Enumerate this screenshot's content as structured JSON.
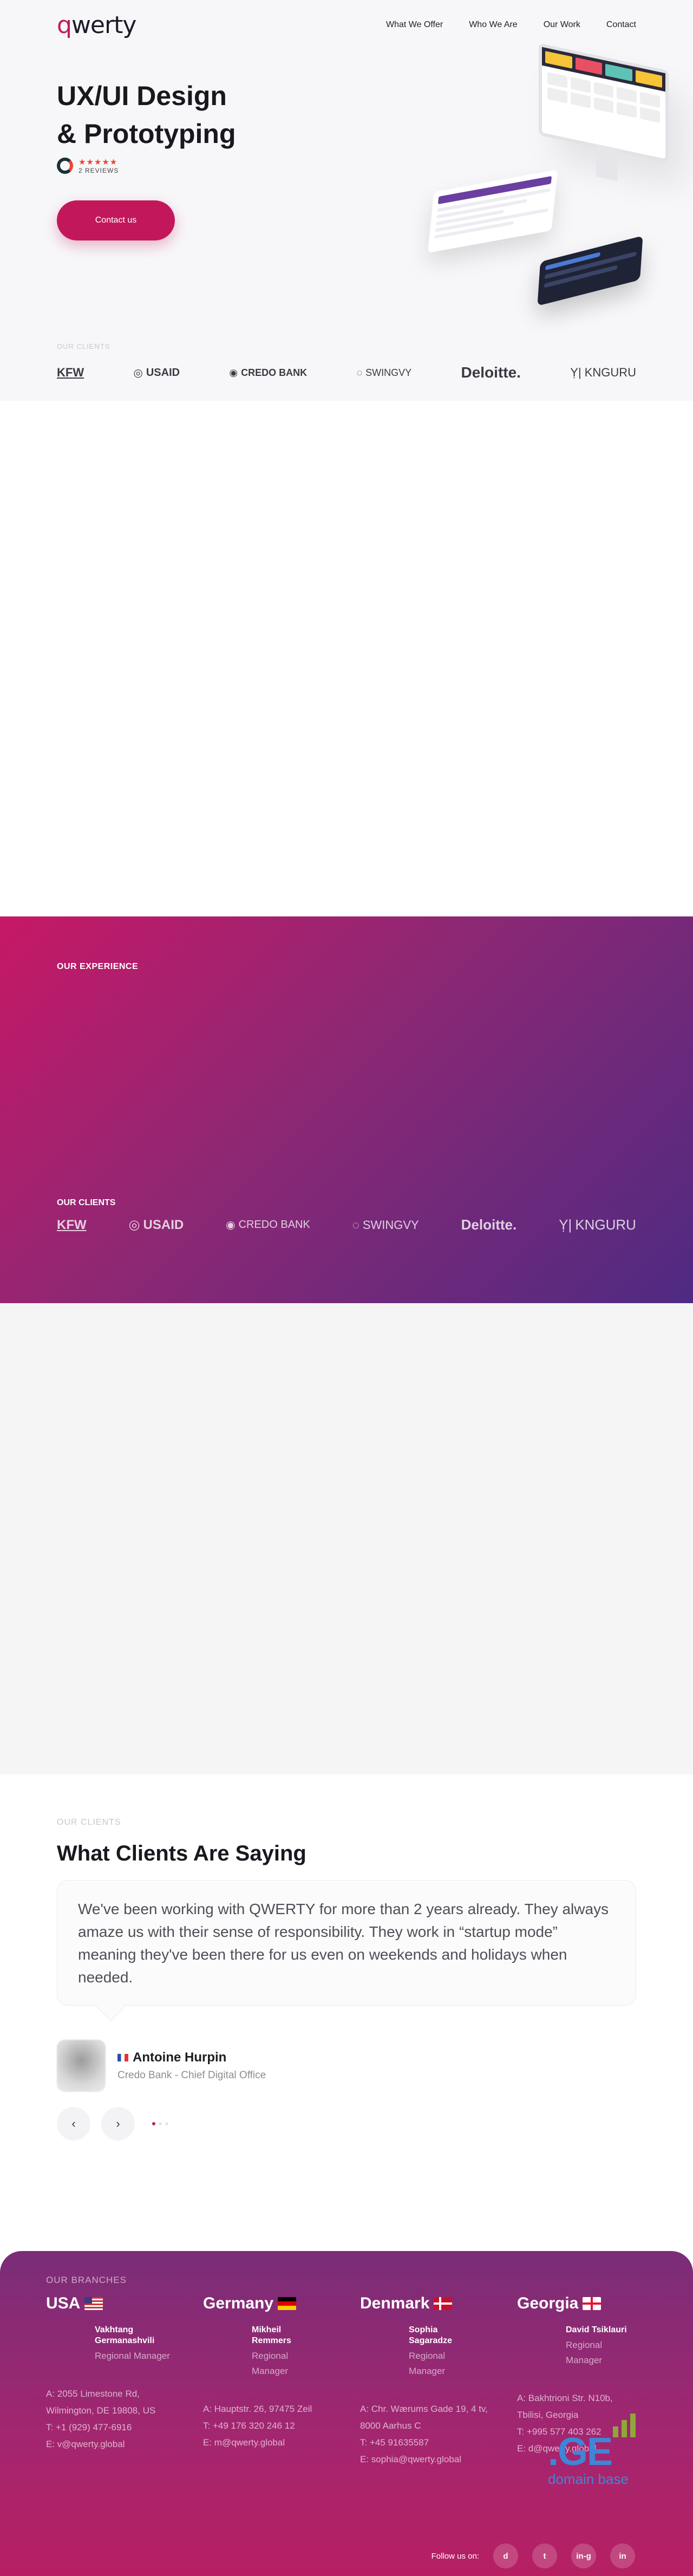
{
  "brand": {
    "logo_prefix": "q",
    "logo_rest": "werty"
  },
  "nav": {
    "items": [
      "What We Offer",
      "Who We Are",
      "Our Work",
      "Contact"
    ]
  },
  "hero": {
    "title_line1": "UX/UI Design",
    "title_line2": "& Prototyping",
    "stars": "★★★★★",
    "reviews": "2 REVIEWS",
    "cta": "Contact us"
  },
  "clients": {
    "label": "OUR CLIENTS",
    "logos": [
      "KFW",
      "USAID",
      "CREDO BANK",
      "SWINGVY",
      "Deloitte.",
      "KNGURU"
    ]
  },
  "experience": {
    "label": "OUR EXPERIENCE",
    "clients_label": "OUR CLIENTS",
    "logos": [
      "KFW",
      "USAID",
      "CREDO BANK",
      "SWINGVY",
      "Deloitte.",
      "KNGURU"
    ]
  },
  "testimonials": {
    "label": "OUR CLIENTS",
    "title": "What Clients Are Saying",
    "quote": "We've been working with QWERTY for more than 2 years already. They always amaze us with their sense of responsibility. They work in “startup mode” meaning they've been there for us even on weekends and holidays when needed.",
    "author_name": "Antoine Hurpin",
    "author_role": "Credo Bank - Chief Digital Office",
    "prev": "‹",
    "next": "›"
  },
  "footer": {
    "branches_label": "OUR BRANCHES",
    "branches": [
      {
        "country": "USA",
        "manager": "Vakhtang Germanashvili",
        "role": "Regional Manager",
        "address": "A:   2055 Limestone Rd, Wilmington, DE 19808, US",
        "phone": "T: +1 (929) 477-6916",
        "email": "E: v@qwerty.global"
      },
      {
        "country": "Germany",
        "manager": "Mikheil Remmers",
        "role": "Regional Manager",
        "address": "A:  Hauptstr. 26, 97475 Zeil",
        "phone": "T: +49 176 320 246 12",
        "email": "E: m@qwerty.global"
      },
      {
        "country": "Denmark",
        "manager": "Sophia Sagaradze",
        "role": "Regional Manager",
        "address": "A:  Chr. Wærums Gade 19, 4 tv, 8000 Aarhus C",
        "phone": "T: +45 91635587",
        "email": "E: sophia@qwerty.global"
      },
      {
        "country": "Georgia",
        "manager": "David Tsiklauri",
        "role": "Regional Manager",
        "address": "A:  Bakhtrioni Str. N10b, Tbilisi, Georgia",
        "phone": "T: +995 577 403 262",
        "email": "E: d@qwerty.global"
      }
    ],
    "follow": "Follow us on:",
    "social": [
      "d",
      "t",
      "in-g",
      "in"
    ],
    "badge_big": ".GE",
    "badge_sub": "domain base"
  }
}
